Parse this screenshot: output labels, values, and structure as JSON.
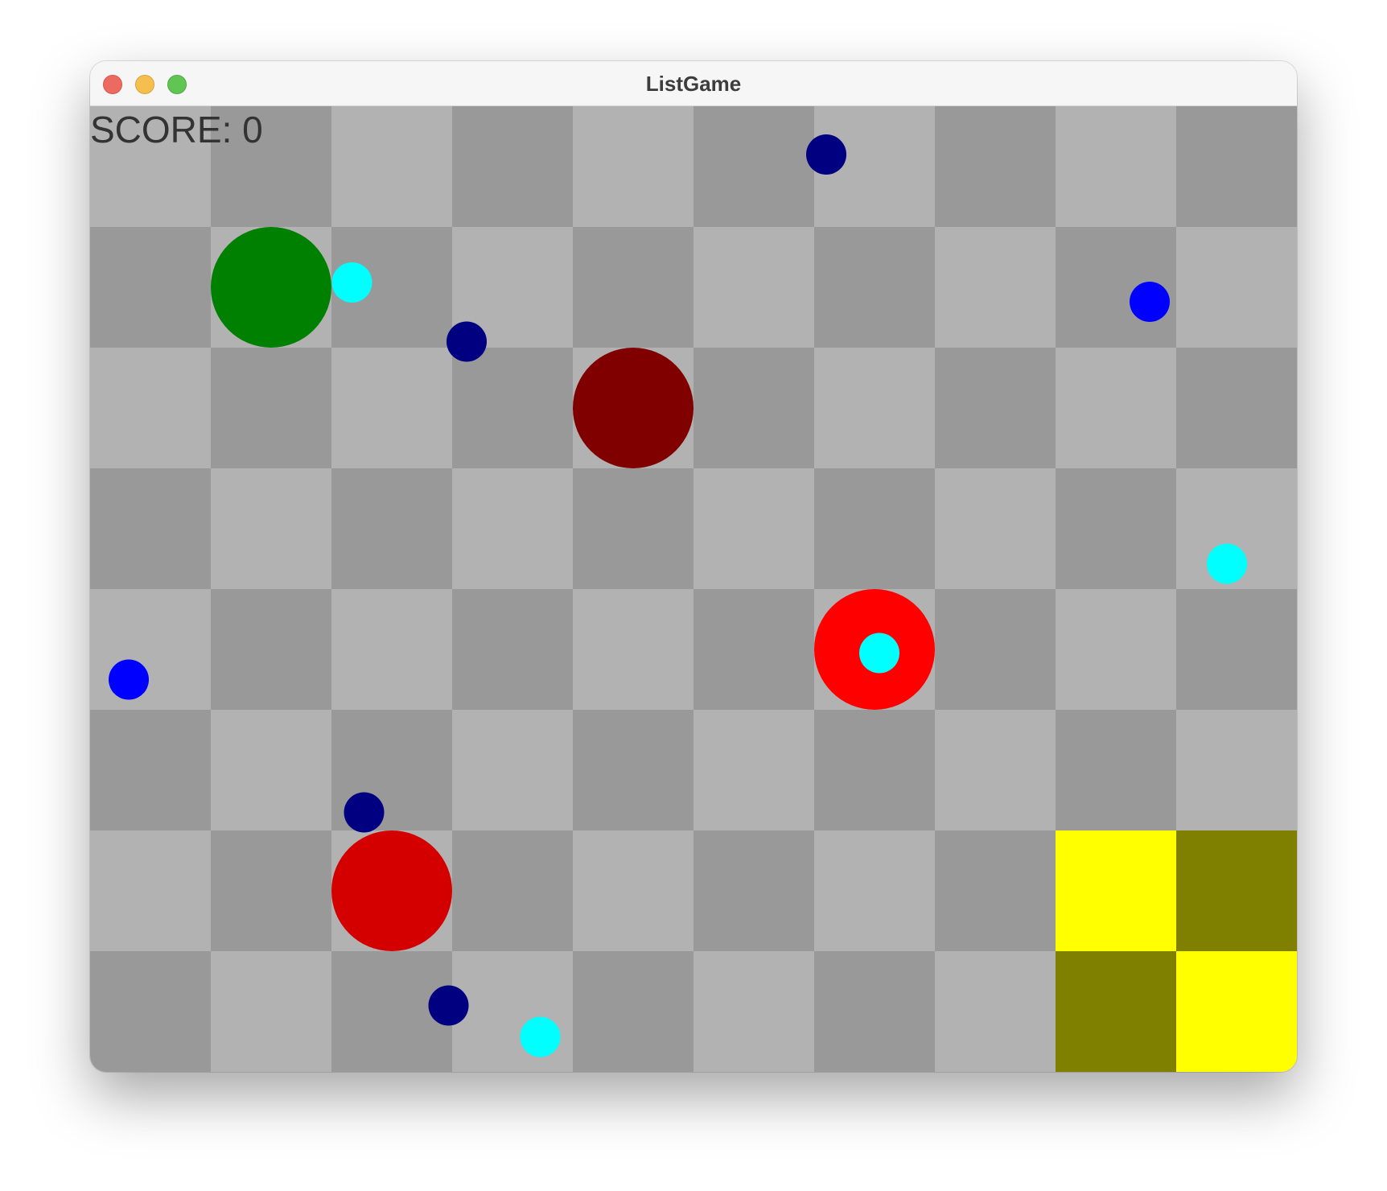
{
  "window": {
    "title": "ListGame"
  },
  "hud": {
    "score_text": "SCORE: 0"
  },
  "colors": {
    "tile_light": "#b2b2b2",
    "tile_dark": "#999999",
    "goal_light": "#ffff00",
    "goal_dark": "#808000"
  },
  "board": {
    "columns": 10,
    "rows": 8,
    "goal_cells": [
      {
        "col": 8,
        "row": 6,
        "tone": "light"
      },
      {
        "col": 9,
        "row": 6,
        "tone": "dark"
      },
      {
        "col": 8,
        "row": 7,
        "tone": "dark"
      },
      {
        "col": 9,
        "row": 7,
        "tone": "light"
      }
    ]
  },
  "entities": [
    {
      "name": "player-green",
      "color": "#008000",
      "kind": "large",
      "col": 1.5,
      "row": 1.5
    },
    {
      "name": "enemy-dark-red",
      "color": "#800000",
      "kind": "large",
      "col": 4.5,
      "row": 2.5
    },
    {
      "name": "enemy-red",
      "color": "#ff0000",
      "kind": "large",
      "col": 6.5,
      "row": 4.5
    },
    {
      "name": "enemy-crimson",
      "color": "#d40000",
      "kind": "large",
      "col": 2.5,
      "row": 6.5
    },
    {
      "name": "pellet-cyan",
      "color": "#00ffff",
      "kind": "small",
      "col": 2.17,
      "row": 1.46
    },
    {
      "name": "pellet-cyan",
      "color": "#00ffff",
      "kind": "small",
      "col": 9.42,
      "row": 3.79
    },
    {
      "name": "pellet-cyan",
      "color": "#00ffff",
      "kind": "small",
      "col": 6.54,
      "row": 4.53
    },
    {
      "name": "pellet-cyan",
      "color": "#00ffff",
      "kind": "small",
      "col": 3.73,
      "row": 7.71
    },
    {
      "name": "pellet-blue",
      "color": "#0000ff",
      "kind": "small",
      "col": 8.78,
      "row": 1.62
    },
    {
      "name": "pellet-blue",
      "color": "#0000ff",
      "kind": "small",
      "col": 0.32,
      "row": 4.75
    },
    {
      "name": "pellet-navy",
      "color": "#000080",
      "kind": "small",
      "col": 6.1,
      "row": 0.4
    },
    {
      "name": "pellet-navy",
      "color": "#000080",
      "kind": "small",
      "col": 3.12,
      "row": 1.95
    },
    {
      "name": "pellet-navy",
      "color": "#000080",
      "kind": "small",
      "col": 2.27,
      "row": 5.85
    },
    {
      "name": "pellet-navy",
      "color": "#000080",
      "kind": "small",
      "col": 2.97,
      "row": 7.45
    }
  ]
}
